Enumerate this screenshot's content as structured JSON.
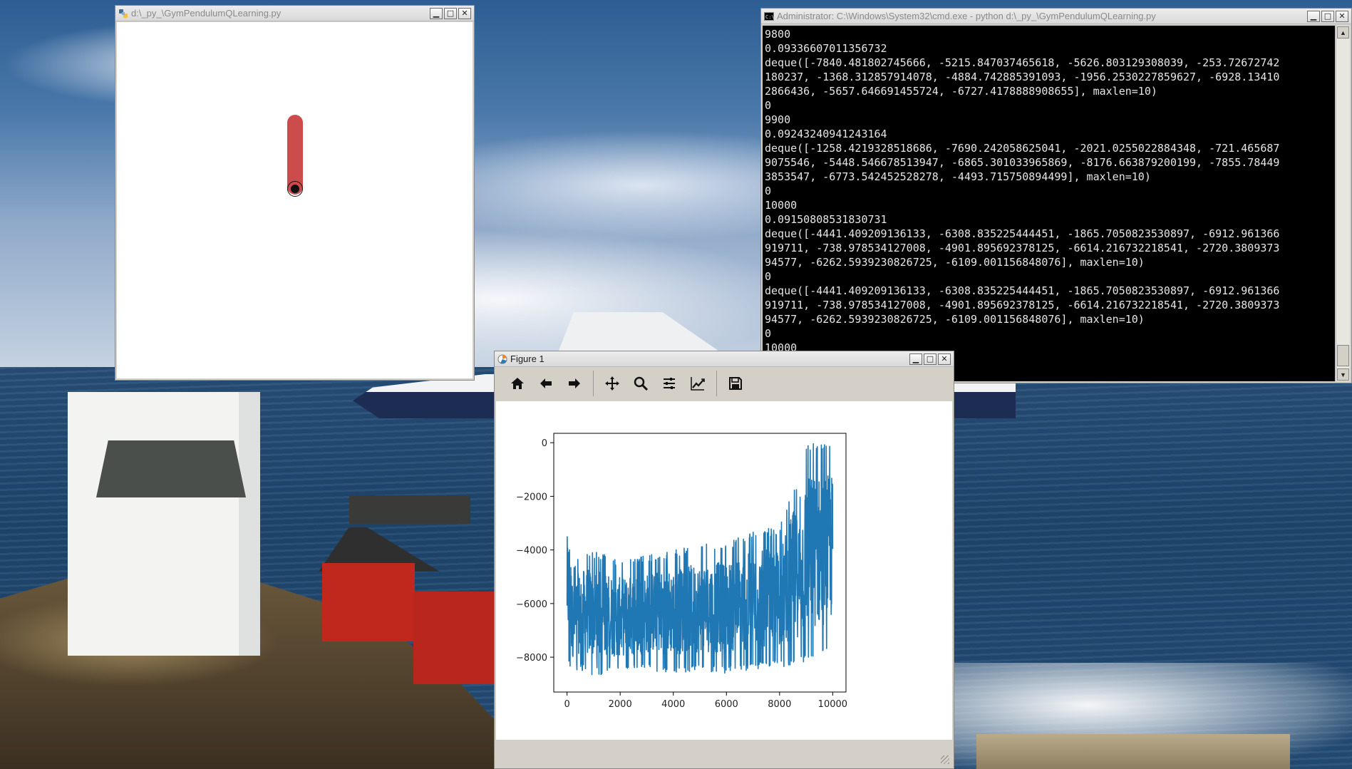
{
  "gym_window": {
    "title": "d:\\_py_\\GymPendulumQLearning.py",
    "pendulum_angle_deg": 0
  },
  "cmd_window": {
    "title": "Administrator: C:\\Windows\\System32\\cmd.exe - python  d:\\_py_\\GymPendulumQLearning.py",
    "lines": [
      "9800",
      "0.09336607011356732",
      "deque([-7840.481802745666, -5215.847037465618, -5626.803129308039, -253.72672742",
      "180237, -1368.312857914078, -4884.742885391093, -1956.2530227859627, -6928.13410",
      "2866436, -5657.646691455724, -6727.4178888908655], maxlen=10)",
      "0",
      "9900",
      "0.09243240941243164",
      "deque([-1258.4219328518686, -7690.242058625041, -2021.0255022884348, -721.465687",
      "9075546, -5448.546678513947, -6865.301033965869, -8176.663879200199, -7855.78449",
      "3853547, -6773.542452528278, -4493.715750894499], maxlen=10)",
      "0",
      "10000",
      "0.09150808531830731",
      "deque([-4441.409209136133, -6308.835225444451, -1865.7050823530897, -6912.961366",
      "919711, -738.978534127008, -4901.895692378125, -6614.216732218541, -2720.3809373",
      "94577, -6262.5939230826725, -6109.001156848076], maxlen=10)",
      "0",
      "deque([-4441.409209136133, -6308.835225444451, -1865.7050823530897, -6912.961366",
      "919711, -738.978534127008, -4901.895692378125, -6614.216732218541, -2720.3809373",
      "94577, -6262.5939230826725, -6109.001156848076], maxlen=10)",
      "0",
      "10000"
    ]
  },
  "figure_window": {
    "title": "Figure 1",
    "toolbar": [
      "home-icon",
      "back-icon",
      "forward-icon",
      "pan-icon",
      "zoom-icon",
      "configure-subplots-icon",
      "edit-axis-icon",
      "save-icon"
    ]
  },
  "chart_data": {
    "type": "line",
    "title": "",
    "xlabel": "",
    "ylabel": "",
    "xlim": [
      -500,
      10500
    ],
    "ylim": [
      -9300,
      350
    ],
    "xticks": [
      0,
      2000,
      4000,
      6000,
      8000,
      10000
    ],
    "yticks": [
      0,
      -2000,
      -4000,
      -6000,
      -8000
    ],
    "grid": false,
    "series": [
      {
        "color": "#1f77b4",
        "x": [
          0,
          100,
          200,
          500,
          1000,
          2000,
          3000,
          4000,
          5000,
          6000,
          7000,
          7500,
          8000,
          8500,
          8800,
          9000,
          9500,
          10000
        ],
        "upper": [
          -2700,
          -2600,
          -4600,
          -4100,
          -4000,
          -4400,
          -4200,
          -4000,
          -3800,
          -3700,
          -3300,
          -3200,
          -3200,
          -1500,
          -1800,
          0,
          0,
          0
        ],
        "lower": [
          -8000,
          -8400,
          -8600,
          -8500,
          -8700,
          -8600,
          -8500,
          -8600,
          -8500,
          -8600,
          -8500,
          -8400,
          -8400,
          -8300,
          -8200,
          -8200,
          -8100,
          -7800
        ]
      }
    ]
  }
}
